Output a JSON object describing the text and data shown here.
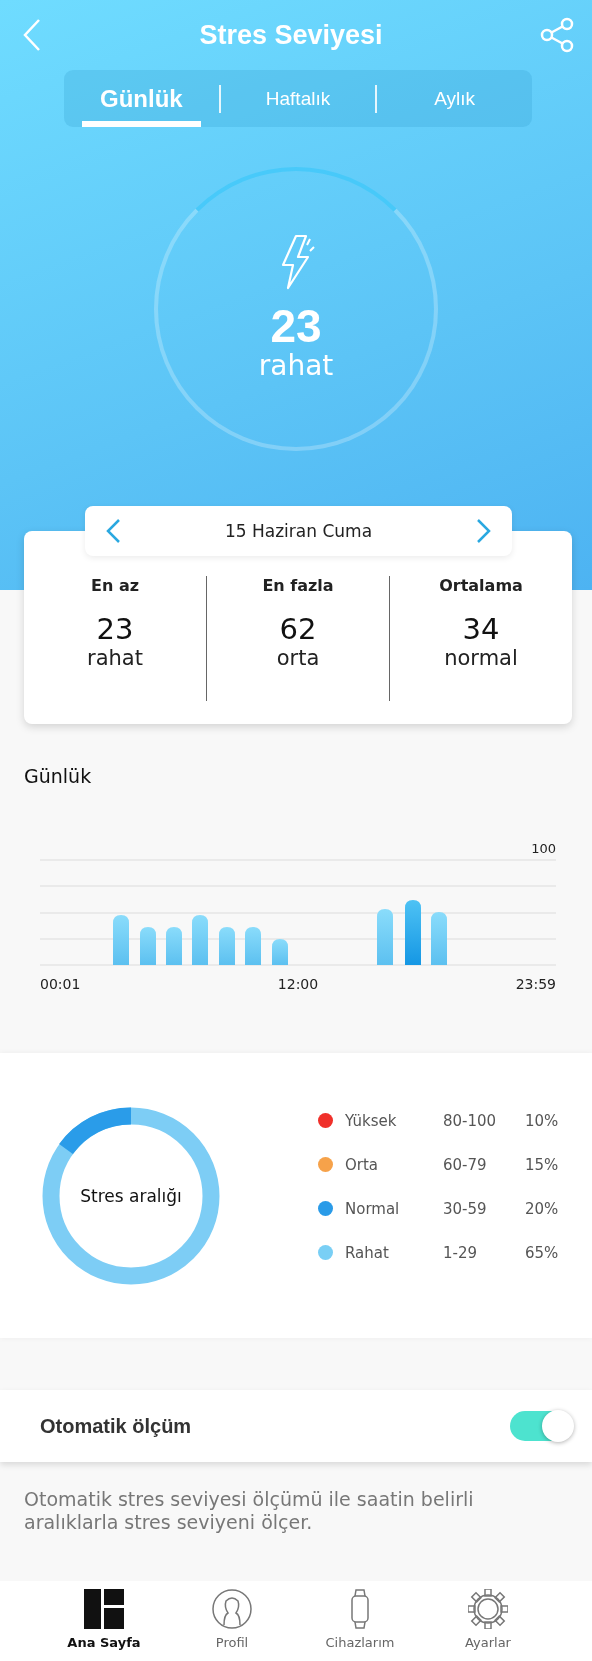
{
  "header": {
    "title": "Stres Seviyesi"
  },
  "tabs": [
    {
      "label": "Günlük",
      "selected": true
    },
    {
      "label": "Haftalık",
      "selected": false
    },
    {
      "label": "Aylık",
      "selected": false
    }
  ],
  "current": {
    "value": "23",
    "status": "rahat"
  },
  "date_nav": {
    "label": "15 Haziran Cuma"
  },
  "stats": [
    {
      "label": "En az",
      "value": "23",
      "status": "rahat"
    },
    {
      "label": "En fazla",
      "value": "62",
      "status": "orta"
    },
    {
      "label": "Ortalama",
      "value": "34",
      "status": "normal"
    }
  ],
  "daily": {
    "title": "Günlük",
    "max_label": "100",
    "x_labels": [
      "00:01",
      "12:00",
      "23:59"
    ]
  },
  "range": {
    "center_label": "Stres aralığı",
    "legend": [
      {
        "name": "Yüksek",
        "range": "80-100",
        "percent": "10%",
        "color": "#f0302a"
      },
      {
        "name": "Orta",
        "range": "60-79",
        "percent": "15%",
        "color": "#f6a24a"
      },
      {
        "name": "Normal",
        "range": "30-59",
        "percent": "20%",
        "color": "#2a9be8"
      },
      {
        "name": "Rahat",
        "range": "1-29",
        "percent": "65%",
        "color": "#79cff5"
      }
    ]
  },
  "auto_measure": {
    "label": "Otomatik ölçüm",
    "on": true,
    "description": "Otomatik stres seviyesi ölçümü ile saatin belirli aralıklarla stres seviyeni ölçer."
  },
  "bottom_nav": [
    {
      "kind": "home",
      "label": "Ana Sayfa",
      "selected": true
    },
    {
      "kind": "profile",
      "label": "Profil",
      "selected": false
    },
    {
      "kind": "devices",
      "label": "Cihazlarım",
      "selected": false
    },
    {
      "kind": "settings",
      "label": "Ayarlar",
      "selected": false
    }
  ]
}
